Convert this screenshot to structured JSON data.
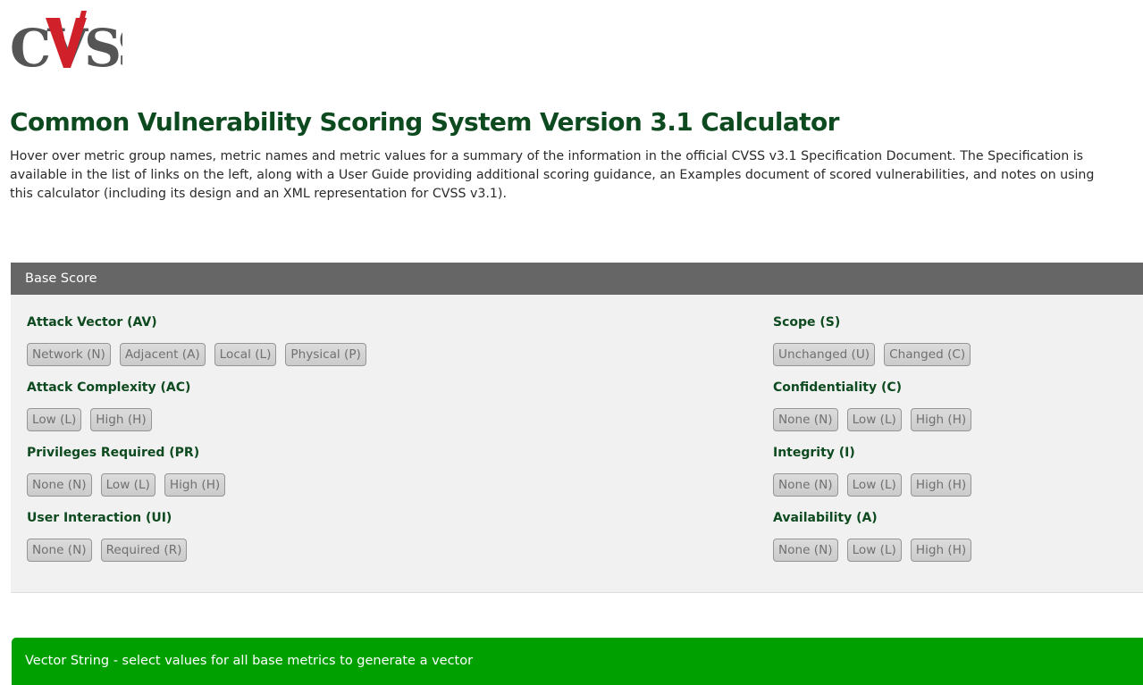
{
  "logo": {
    "text": "CVSS"
  },
  "title": "Common Vulnerability Scoring System Version 3.1 Calculator",
  "intro": "Hover over metric group names, metric names and metric values for a summary of the information in the official CVSS v3.1 Specification Document. The Specification is available in the list of links on the left, along with a User Guide providing additional scoring guidance, an Examples document of scored vulnerabilities, and notes on using this calculator (including its design and an XML representation for CVSS v3.1).",
  "base_score": {
    "header": "Base Score",
    "left_metrics": [
      {
        "label": "Attack Vector (AV)",
        "options": [
          "Network (N)",
          "Adjacent (A)",
          "Local (L)",
          "Physical (P)"
        ]
      },
      {
        "label": "Attack Complexity (AC)",
        "options": [
          "Low (L)",
          "High (H)"
        ]
      },
      {
        "label": "Privileges Required (PR)",
        "options": [
          "None (N)",
          "Low (L)",
          "High (H)"
        ]
      },
      {
        "label": "User Interaction (UI)",
        "options": [
          "None (N)",
          "Required (R)"
        ]
      }
    ],
    "right_metrics": [
      {
        "label": "Scope (S)",
        "options": [
          "Unchanged (U)",
          "Changed (C)"
        ]
      },
      {
        "label": "Confidentiality (C)",
        "options": [
          "None (N)",
          "Low (L)",
          "High (H)"
        ]
      },
      {
        "label": "Integrity (I)",
        "options": [
          "None (N)",
          "Low (L)",
          "High (H)"
        ]
      },
      {
        "label": "Availability (A)",
        "options": [
          "None (N)",
          "Low (L)",
          "High (H)"
        ]
      }
    ]
  },
  "vector_string": "Vector String - select values for all base metrics to generate a vector",
  "colors": {
    "title_green": "#0e4a1f",
    "header_gray": "#666666",
    "panel_bg": "#f1f1f1",
    "vector_green": "#00a000",
    "logo_gray": "#555555",
    "logo_red": "#d0202a"
  }
}
